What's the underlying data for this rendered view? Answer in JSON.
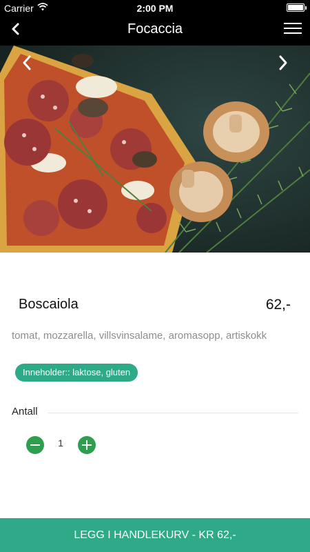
{
  "status_bar": {
    "carrier": "Carrier",
    "time": "2:00 PM"
  },
  "nav": {
    "title": "Focaccia"
  },
  "product": {
    "name": "Boscaiola",
    "price": "62,-",
    "description": "tomat, mozzarella, villsvinsalame, aromasopp, artiskokk",
    "allergens": "Inneholder:: laktose, gluten"
  },
  "quantity": {
    "label": "Antall",
    "value": "1"
  },
  "cart_button": {
    "label": "LEGG I HANDLEKURV - KR 62,-"
  },
  "colors": {
    "accent": "#2eaa88",
    "stepper": "#2e9f4e",
    "bar_background": "#000000"
  }
}
